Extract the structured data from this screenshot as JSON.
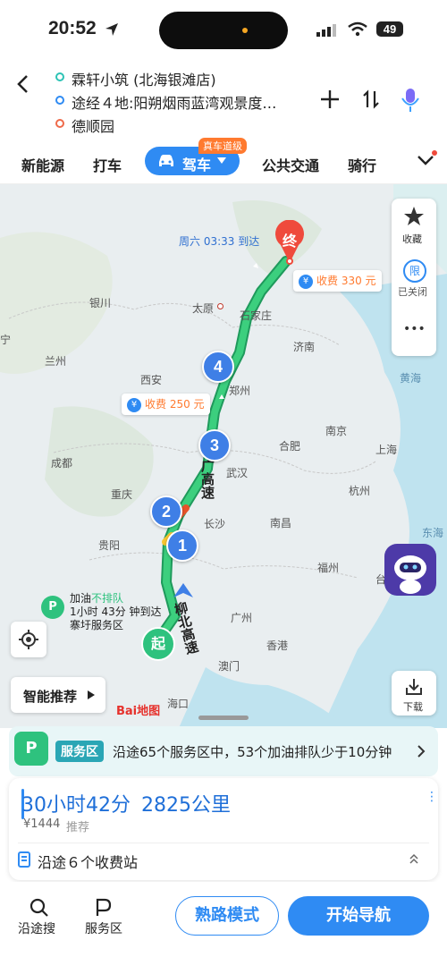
{
  "status_bar": {
    "time": "20:52",
    "battery": "49"
  },
  "header": {
    "origin": "霖轩小筑 (北海银滩店)",
    "waypoints": "途经４地:阳朔烟雨蓝湾观景度…",
    "destination": "德顺园"
  },
  "tabs": {
    "items": [
      "新能源",
      "打车",
      "公共交通",
      "骑行"
    ],
    "drive_label": "驾车",
    "drive_badge": "真车道级"
  },
  "map": {
    "arrival": "周六 03:33 到达",
    "end_label": "终",
    "start_label": "起",
    "toll_top": "收费 330 元",
    "toll_mid": "收费 250 元",
    "markers": [
      "1",
      "2",
      "3",
      "4"
    ],
    "favorite": "收藏",
    "limit_icon": "限",
    "limit_status": "已关闭",
    "more": "•••",
    "download": "下载",
    "smart_recommend": "智能推荐",
    "fuel_title_prefix": "加油",
    "fuel_title_status": "不排队",
    "fuel_line2": "1小时 43分 钟到达",
    "fuel_line3": "寨圩服务区",
    "road_name_1": "柳北高速",
    "road_name_2": "广高速",
    "baidu_logo": "Bai地图",
    "places": [
      {
        "name": "银川"
      },
      {
        "name": "太原"
      },
      {
        "name": "石家庄"
      },
      {
        "name": "济南"
      },
      {
        "name": "兰州"
      },
      {
        "name": "西安"
      },
      {
        "name": "郑州"
      },
      {
        "name": "黄海"
      },
      {
        "name": "宁"
      },
      {
        "name": "南京"
      },
      {
        "name": "合肥"
      },
      {
        "name": "上海"
      },
      {
        "name": "成都"
      },
      {
        "name": "武汉"
      },
      {
        "name": "杭州"
      },
      {
        "name": "重庆"
      },
      {
        "name": "长沙"
      },
      {
        "name": "南昌"
      },
      {
        "name": "东海"
      },
      {
        "name": "贵阳"
      },
      {
        "name": "福州"
      },
      {
        "name": "台"
      },
      {
        "name": "广州"
      },
      {
        "name": "香港"
      },
      {
        "name": "澳门"
      },
      {
        "name": "海口"
      }
    ]
  },
  "service_banner": {
    "badge": "服务区",
    "text": "沿途65个服务区中，53个加油排队少于10分钟"
  },
  "route_card": {
    "duration": "30小时42分",
    "distance": "2825公里",
    "cost": "¥1444",
    "cost_tag": "推荐",
    "toll_stations": "沿途６个收费站"
  },
  "bottom_bar": {
    "search_along": "沿途搜",
    "service_area": "服务区",
    "familiar_mode": "熟路模式",
    "start_nav": "开始导航"
  },
  "colors": {
    "accent": "#2f8bf3",
    "route": "#2ec27e",
    "toll": "#ff7a2f",
    "end": "#ef4a3c"
  }
}
